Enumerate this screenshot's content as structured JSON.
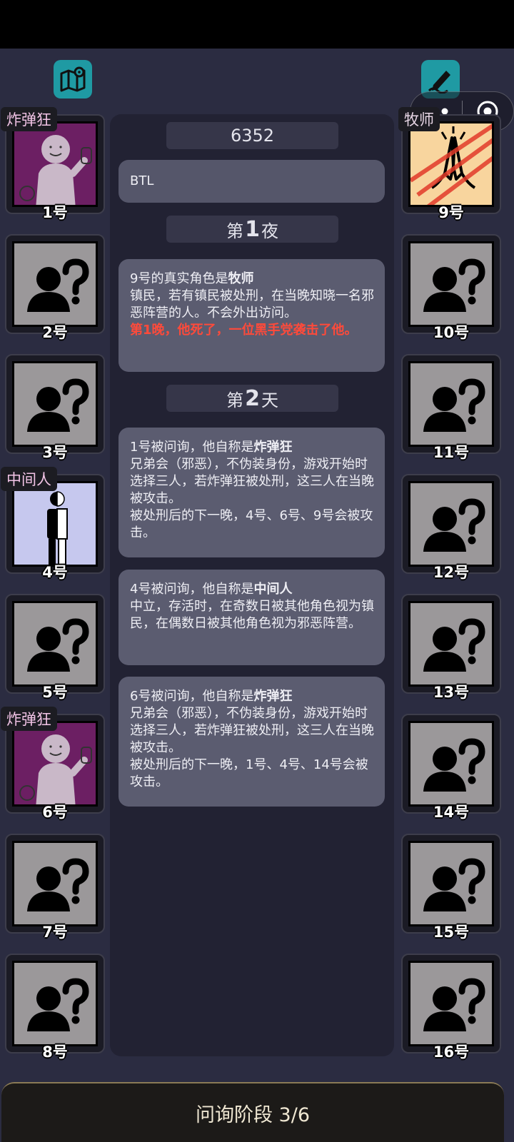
{
  "game": {
    "room_code": "6352",
    "player_name": "BTL",
    "night1": {
      "prefix": "第",
      "num": "1",
      "suffix": "夜"
    },
    "day2": {
      "prefix": "第",
      "num": "2",
      "suffix": "天"
    },
    "phase": "问询阶段 3/6"
  },
  "icons": {
    "map": "map-pin-icon",
    "edit": "pen-edit-icon",
    "more": "more-dots-icon",
    "close": "target-close-icon"
  },
  "colors": {
    "accent": "#1f9aa3",
    "alert": "#ff4a3a",
    "panel": "#222233",
    "bubble": "#5b5c70"
  },
  "players_left": [
    {
      "num": "1号",
      "tag": "炸弹狂",
      "art": "bomber"
    },
    {
      "num": "2号",
      "tag": "",
      "art": "unknown"
    },
    {
      "num": "3号",
      "tag": "",
      "art": "unknown"
    },
    {
      "num": "4号",
      "tag": "中间人",
      "art": "middleman"
    },
    {
      "num": "5号",
      "tag": "",
      "art": "unknown"
    },
    {
      "num": "6号",
      "tag": "炸弹狂",
      "art": "bomber"
    },
    {
      "num": "7号",
      "tag": "",
      "art": "unknown"
    },
    {
      "num": "8号",
      "tag": "",
      "art": "unknown"
    }
  ],
  "players_right": [
    {
      "num": "9号",
      "tag": "牧师",
      "art": "priest-dead"
    },
    {
      "num": "10号",
      "tag": "",
      "art": "unknown"
    },
    {
      "num": "11号",
      "tag": "",
      "art": "unknown"
    },
    {
      "num": "12号",
      "tag": "",
      "art": "unknown"
    },
    {
      "num": "13号",
      "tag": "",
      "art": "unknown"
    },
    {
      "num": "14号",
      "tag": "",
      "art": "unknown"
    },
    {
      "num": "15号",
      "tag": "",
      "art": "unknown"
    },
    {
      "num": "16号",
      "tag": "",
      "art": "unknown"
    }
  ],
  "log": {
    "night1_msg": {
      "pre": "9号的真实角色是",
      "role": "牧师",
      "desc": "镇民，若有镇民被处刑，在当晚知晓一名邪恶阵营的人。不会外出访问。",
      "alert": "第1晚，他死了，一位黑手党袭击了他。"
    },
    "q1": {
      "pre": "1号被问询，他自称是",
      "role": "炸弹狂",
      "desc": "兄弟会（邪恶），不伪装身份，游戏开始时选择三人，若炸弹狂被处刑，这三人在当晚被攻击。",
      "extra": "被处刑后的下一晚，4号、6号、9号会被攻击。"
    },
    "q2": {
      "pre": "4号被问询，他自称是",
      "role": "中间人",
      "desc": "中立，存活时，在奇数日被其他角色视为镇民，在偶数日被其他角色视为邪恶阵营。"
    },
    "q3": {
      "pre": "6号被问询，他自称是",
      "role": "炸弹狂",
      "desc": "兄弟会（邪恶），不伪装身份，游戏开始时选择三人，若炸弹狂被处刑，这三人在当晚被攻击。",
      "extra": "被处刑后的下一晚，1号、4号、14号会被攻击。"
    }
  }
}
